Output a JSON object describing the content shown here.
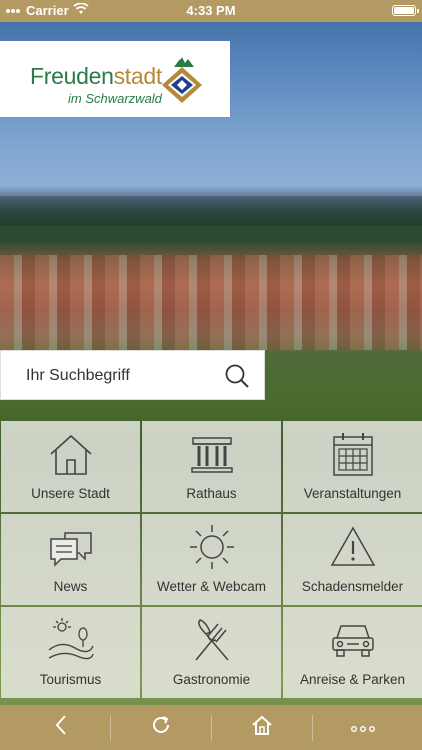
{
  "status_bar": {
    "carrier": "Carrier",
    "time": "4:33 PM"
  },
  "logo": {
    "name_part1": "Freuden",
    "name_part2": "stadt",
    "subtitle": "im Schwarzwald"
  },
  "search": {
    "placeholder": "Ihr Suchbegriff"
  },
  "tiles": [
    {
      "label": "Unsere Stadt",
      "icon": "house-icon"
    },
    {
      "label": "Rathaus",
      "icon": "town-hall-icon"
    },
    {
      "label": "Veranstaltungen",
      "icon": "calendar-icon"
    },
    {
      "label": "News",
      "icon": "chat-bubbles-icon"
    },
    {
      "label": "Wetter & Webcam",
      "icon": "sun-icon"
    },
    {
      "label": "Schadensmelder",
      "icon": "warning-icon"
    },
    {
      "label": "Tourismus",
      "icon": "landscape-icon"
    },
    {
      "label": "Gastronomie",
      "icon": "cutlery-icon"
    },
    {
      "label": "Anreise & Parken",
      "icon": "car-icon"
    }
  ],
  "bottom_bar": {
    "items": [
      {
        "icon": "back-icon"
      },
      {
        "icon": "reload-icon"
      },
      {
        "icon": "home-icon"
      },
      {
        "icon": "more-icon"
      }
    ]
  },
  "colors": {
    "accent": "#b39a63",
    "tile_bg": "#ecece6",
    "logo_green": "#2a7a4a",
    "logo_gold": "#b38a3a"
  }
}
